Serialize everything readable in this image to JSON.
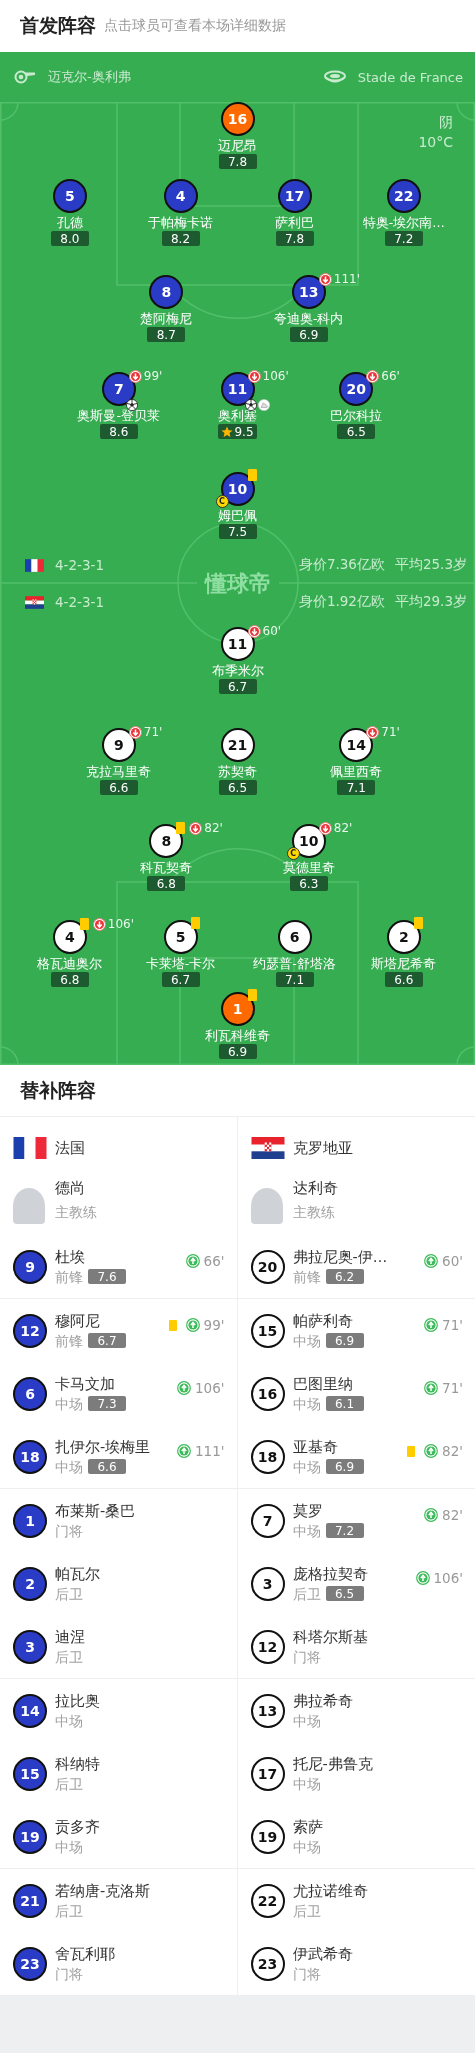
{
  "header": {
    "title": "首发阵容",
    "subtitle": "点击球员可查看本场详细数据"
  },
  "match_info": {
    "referee": "迈克尔-奥利弗",
    "stadium": "Stade de France",
    "weather": "阴",
    "temperature": "10°C"
  },
  "pitch": {
    "logo": "懂球帝",
    "home": {
      "kind": "home",
      "rows": [
        [
          {
            "number": "16",
            "name": "迈尼昂",
            "rating": "7.8",
            "kind": "goalkeeper",
            "yellow_card": false
          }
        ],
        [
          {
            "number": "5",
            "name": "孔德",
            "rating": "8.0",
            "kind": "outfield",
            "yellow_card": false
          },
          {
            "number": "4",
            "name": "于帕梅卡诺",
            "rating": "8.2",
            "kind": "outfield",
            "yellow_card": false
          },
          {
            "number": "17",
            "name": "萨利巴",
            "rating": "7.8",
            "kind": "outfield",
            "yellow_card": false
          },
          {
            "number": "22",
            "name": "特奥-埃尔南…",
            "rating": "7.2",
            "kind": "outfield",
            "yellow_card": false
          }
        ],
        [
          {
            "number": "8",
            "name": "楚阿梅尼",
            "rating": "8.7",
            "kind": "outfield",
            "yellow_card": false
          },
          {
            "number": "13",
            "name": "夸迪奥-科内",
            "rating": "6.9",
            "kind": "outfield",
            "yellow_card": false,
            "sub_off": "111'"
          }
        ],
        [
          {
            "number": "7",
            "name": "奥斯曼-登贝莱",
            "rating": "8.6",
            "kind": "outfield",
            "yellow_card": false,
            "sub_off": "99'",
            "goal": true
          },
          {
            "number": "11",
            "name": "奥利塞",
            "rating": "9.5",
            "kind": "outfield",
            "yellow_card": false,
            "sub_off": "106'",
            "goal": true,
            "assist": true,
            "mvp": true
          },
          {
            "number": "20",
            "name": "巴尔科拉",
            "rating": "6.5",
            "kind": "outfield",
            "yellow_card": false,
            "sub_off": "66'"
          }
        ],
        [
          {
            "number": "10",
            "name": "姆巴佩",
            "rating": "7.5",
            "kind": "outfield",
            "yellow_card": true,
            "captain_badge": "C"
          }
        ]
      ]
    },
    "summary": [
      {
        "flag": {
          "kind": "france"
        },
        "formation": "4-2-3-1",
        "value": "身价7.36亿欧",
        "age": "平均25.3岁"
      },
      {
        "flag": {
          "kind": "croatia"
        },
        "formation": "4-2-3-1",
        "value": "身价1.92亿欧",
        "age": "平均29.3岁"
      }
    ],
    "away": {
      "kind": "away",
      "rows": [
        [
          {
            "number": "11",
            "name": "布季米尔",
            "rating": "6.7",
            "kind": "outfield",
            "yellow_card": false,
            "sub_off": "60'"
          }
        ],
        [
          {
            "number": "9",
            "name": "克拉马里奇",
            "rating": "6.6",
            "kind": "outfield",
            "yellow_card": false,
            "sub_off": "71'"
          },
          {
            "number": "21",
            "name": "苏契奇",
            "rating": "6.5",
            "kind": "outfield",
            "yellow_card": false
          },
          {
            "number": "14",
            "name": "佩里西奇",
            "rating": "7.1",
            "kind": "outfield",
            "yellow_card": false,
            "sub_off": "71'"
          }
        ],
        [
          {
            "number": "8",
            "name": "科瓦契奇",
            "rating": "6.8",
            "kind": "outfield",
            "yellow_card": true,
            "sub_off": "82'"
          },
          {
            "number": "10",
            "name": "莫德里奇",
            "rating": "6.3",
            "kind": "outfield",
            "yellow_card": false,
            "sub_off": "82'",
            "captain_badge": "C"
          }
        ],
        [
          {
            "number": "4",
            "name": "格瓦迪奥尔",
            "rating": "6.8",
            "kind": "outfield",
            "yellow_card": true,
            "sub_off": "106'"
          },
          {
            "number": "5",
            "name": "卡莱塔-卡尔",
            "rating": "6.7",
            "kind": "outfield",
            "yellow_card": true
          },
          {
            "number": "6",
            "name": "约瑟普-舒塔洛",
            "rating": "7.1",
            "kind": "outfield",
            "yellow_card": false
          },
          {
            "number": "2",
            "name": "斯塔尼希奇",
            "rating": "6.6",
            "kind": "outfield",
            "yellow_card": true
          }
        ],
        [
          {
            "number": "1",
            "name": "利瓦科维奇",
            "rating": "6.9",
            "kind": "goalkeeper",
            "yellow_card": true
          }
        ]
      ]
    }
  },
  "substitutes": {
    "title": "替补阵容",
    "columns": [
      {
        "kind": "home",
        "flag": {
          "kind": "france"
        },
        "team": "法国",
        "coach": {
          "name": "德尚",
          "role": "主教练"
        },
        "groups": [
          [
            {
              "number": "9",
              "name": "杜埃",
              "position": "前锋",
              "rating": "7.6",
              "yellow_card": false,
              "sub_in": "66'"
            }
          ],
          [
            {
              "number": "12",
              "name": "穆阿尼",
              "position": "前锋",
              "rating": "6.7",
              "yellow_card": true,
              "sub_in": "99'"
            },
            {
              "number": "6",
              "name": "卡马文加",
              "position": "中场",
              "rating": "7.3",
              "yellow_card": false,
              "sub_in": "106'"
            },
            {
              "number": "18",
              "name": "扎伊尔-埃梅里",
              "position": "中场",
              "rating": "6.6",
              "yellow_card": false,
              "sub_in": "111'"
            }
          ],
          [
            {
              "number": "1",
              "name": "布莱斯-桑巴",
              "position": "门将",
              "yellow_card": false
            },
            {
              "number": "2",
              "name": "帕瓦尔",
              "position": "后卫",
              "yellow_card": false
            },
            {
              "number": "3",
              "name": "迪涅",
              "position": "后卫",
              "yellow_card": false
            }
          ],
          [
            {
              "number": "14",
              "name": "拉比奥",
              "position": "中场",
              "yellow_card": false
            },
            {
              "number": "15",
              "name": "科纳特",
              "position": "后卫",
              "yellow_card": false
            },
            {
              "number": "19",
              "name": "贡多齐",
              "position": "中场",
              "yellow_card": false
            }
          ],
          [
            {
              "number": "21",
              "name": "若纳唐-克洛斯",
              "position": "后卫",
              "yellow_card": false
            },
            {
              "number": "23",
              "name": "舍瓦利耶",
              "position": "门将",
              "yellow_card": false
            }
          ]
        ]
      },
      {
        "kind": "away",
        "flag": {
          "kind": "croatia"
        },
        "team": "克罗地亚",
        "coach": {
          "name": "达利奇",
          "role": "主教练"
        },
        "groups": [
          [
            {
              "number": "20",
              "name": "弗拉尼奥-伊…",
              "position": "前锋",
              "rating": "6.2",
              "yellow_card": false,
              "sub_in": "60'"
            }
          ],
          [
            {
              "number": "15",
              "name": "帕萨利奇",
              "position": "中场",
              "rating": "6.9",
              "yellow_card": false,
              "sub_in": "71'"
            },
            {
              "number": "16",
              "name": "巴图里纳",
              "position": "中场",
              "rating": "6.1",
              "yellow_card": false,
              "sub_in": "71'"
            },
            {
              "number": "18",
              "name": "亚基奇",
              "position": "中场",
              "rating": "6.9",
              "yellow_card": true,
              "sub_in": "82'"
            }
          ],
          [
            {
              "number": "7",
              "name": "莫罗",
              "position": "中场",
              "rating": "7.2",
              "yellow_card": false,
              "sub_in": "82'"
            },
            {
              "number": "3",
              "name": "庞格拉契奇",
              "position": "后卫",
              "rating": "6.5",
              "yellow_card": false,
              "sub_in": "106'"
            },
            {
              "number": "12",
              "name": "科塔尔斯基",
              "position": "门将",
              "yellow_card": false
            }
          ],
          [
            {
              "number": "13",
              "name": "弗拉希奇",
              "position": "中场",
              "yellow_card": false
            },
            {
              "number": "17",
              "name": "托尼-弗鲁克",
              "position": "中场",
              "yellow_card": false
            },
            {
              "number": "19",
              "name": "索萨",
              "position": "中场",
              "yellow_card": false
            }
          ],
          [
            {
              "number": "22",
              "name": "尤拉诺维奇",
              "position": "后卫",
              "yellow_card": false
            },
            {
              "number": "23",
              "name": "伊武希奇",
              "position": "门将",
              "yellow_card": false
            }
          ]
        ]
      }
    ]
  }
}
